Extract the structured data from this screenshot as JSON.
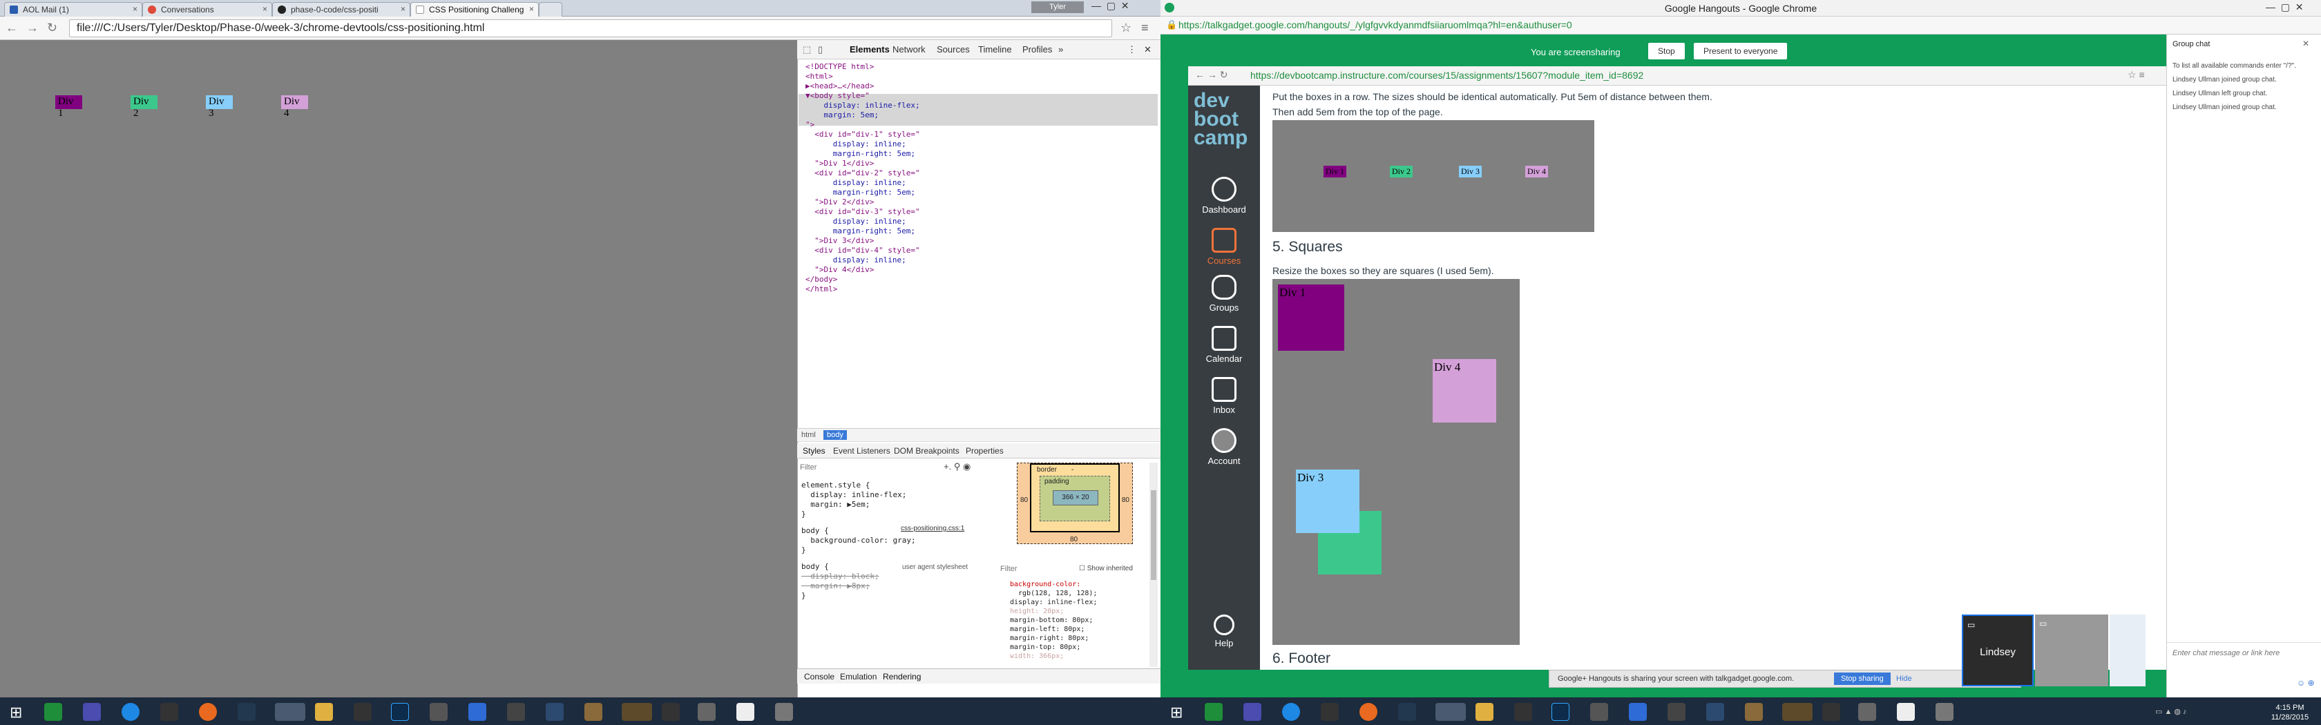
{
  "left_window": {
    "tabs": [
      "AOL Mail (1)",
      "Conversations",
      "phase-0-code/css-positi",
      "CSS Positioning Challeng"
    ],
    "tray_label": "Tyler",
    "url": "file:///C:/Users/Tyler/Desktop/Phase-0/week-3/chrome-devtools/css-positioning.html",
    "page_divs": [
      "Div 1",
      "Div 2",
      "Div 3",
      "Div 4"
    ],
    "colors": {
      "div1": "#800080",
      "div2": "#3cc88c",
      "div3": "#87cefa",
      "div4": "#d4a0d8",
      "page": "#808080"
    },
    "devtools": {
      "tabs": [
        "Elements",
        "Network",
        "Sources",
        "Timeline",
        "Profiles"
      ],
      "dom_lines": [
        "<!DOCTYPE html>",
        "<html>",
        "▶<head>…</head>",
        "▼<body style=\"",
        "    display: inline-flex;",
        "    margin: 5em;",
        "\">",
        "  <div id=\"div-1\" style=\"",
        "      display: inline;",
        "      margin-right: 5em;",
        "  \">Div 1</div>",
        "  <div id=\"div-2\" style=\"",
        "      display: inline;",
        "      margin-right: 5em;",
        "  \">Div 2</div>",
        "  <div id=\"div-3\" style=\"",
        "      display: inline;",
        "      margin-right: 5em;",
        "  \">Div 3</div>",
        "  <div id=\"div-4\" style=\"",
        "      display: inline;",
        "  \">Div 4</div>",
        "</body>",
        "</html>"
      ],
      "breadcrumb": [
        "html",
        "body"
      ],
      "sub_tabs": [
        "Styles",
        "Event Listeners",
        "DOM Breakpoints",
        "Properties"
      ],
      "filter_placeholder": "Filter",
      "styles_lines": [
        "element.style {",
        "  display: inline-flex;",
        "  margin: ▶5em;",
        "}",
        "body {",
        "  background-color: gray;",
        "}",
        "body {",
        "  display: block;",
        "  margin: ▶8px;",
        "}"
      ],
      "styles_source": "css-positioning.css:1",
      "ua_label": "user agent stylesheet",
      "boxmodel": {
        "border": "border",
        "padding": "padding",
        "content": "366 × 20",
        "dash": "-",
        "margin_val": "80"
      },
      "computed_filter": "Filter",
      "show_inherited": "Show inherited",
      "computed_lines": [
        "background-color:",
        "  rgb(128, 128, 128);",
        "display: inline-flex;",
        "height: 20px;",
        "margin-bottom: 80px;",
        "margin-left: 80px;",
        "margin-right: 80px;",
        "margin-top: 80px;",
        "width: 366px;"
      ],
      "drawer_tabs": [
        "Console",
        "Emulation",
        "Rendering"
      ]
    }
  },
  "right_window": {
    "title": "Google Hangouts - Google Chrome",
    "url": "https://talkgadget.google.com/hangouts/_/ylgfgvvkdyanmdfsiiaruomlmqa?hl=en&authuser=0",
    "screenshare_bar": {
      "text": "You are screensharing",
      "stop": "Stop",
      "present": "Present to everyone"
    },
    "inner_url": "https://devbootcamp.instructure.com/courses/15/assignments/15607?module_item_id=8692",
    "logo": [
      "dev",
      "boot",
      "camp"
    ],
    "sidebar": [
      "Dashboard",
      "Courses",
      "Groups",
      "Calendar",
      "Inbox",
      "Account",
      "Help"
    ],
    "text1": "Put the boxes in a row. The sizes should be identical automatically. Put 5em of distance between them.",
    "text2": "Then add 5em from the top of the page.",
    "preview_divs": [
      "Div 1",
      "Div 2",
      "Div 3",
      "Div 4"
    ],
    "heading_squares": "5. Squares",
    "text3": "Resize the boxes so they are squares (I used 5em).",
    "squares": [
      "Div 1",
      "Div 4",
      "Div 3"
    ],
    "heading_footer": "6. Footer",
    "share_bar": {
      "text": "Google+ Hangouts is sharing your screen with talkgadget.google.com.",
      "stop": "Stop sharing",
      "hide": "Hide"
    },
    "participant": "Lindsey",
    "chat": {
      "title": "Group chat",
      "lines": [
        "To list all available commands enter \"/?\".",
        "Lindsey Ullman joined group chat.",
        "Lindsey Ullman left group chat.",
        "Lindsey Ullman joined group chat."
      ],
      "placeholder": "Enter chat message or link here"
    }
  },
  "taskbar": {
    "time": "4:15 PM",
    "date": "11/28/2015"
  }
}
